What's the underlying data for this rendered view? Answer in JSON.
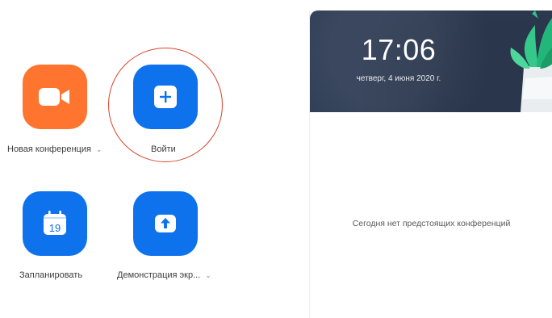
{
  "actions": {
    "new_meeting": {
      "label": "Новая конференция",
      "chevron": "⌄",
      "icon": "video-camera-icon",
      "color": "#ff742e"
    },
    "join": {
      "label": "Войти",
      "icon": "plus-icon",
      "color": "#0e72ed"
    },
    "schedule": {
      "label": "Запланировать",
      "icon": "calendar-icon",
      "calendar_day": "19",
      "color": "#0e72ed"
    },
    "share_screen": {
      "label": "Демонстрация экр...",
      "chevron": "⌄",
      "icon": "share-up-arrow-icon",
      "color": "#0e72ed"
    }
  },
  "highlight": {
    "color": "#d8442b"
  },
  "upcoming": {
    "time": "17:06",
    "date": "четверг, 4 июня 2020 г.",
    "empty_message": "Сегодня нет предстоящих конференций"
  }
}
